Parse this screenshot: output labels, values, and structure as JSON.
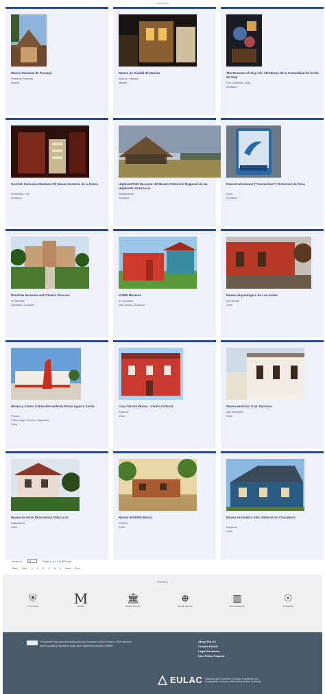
{
  "museums": [
    {
      "title": "Museo Nacional de Panamá",
      "lines": [
        "Panamá, Panamá",
        "Madrid"
      ]
    },
    {
      "title": "Museo de Ciudad de Mexico",
      "lines": [
        "Ramos, Oaxaca",
        "Madrid"
      ]
    },
    {
      "title": "The Museum of Islay Life / El Museo de la Comunidad de la Isla de Islay",
      "lines": [
        "Port Charlotte, Islay",
        "Scotland"
      ]
    },
    {
      "title": "Scottish Fisheries Museum / El Museo Escocés de la Pesca",
      "lines": [
        "Anstruther, Fife",
        "Scotland"
      ]
    },
    {
      "title": "Highland Folk Museum / El Museo Folclórico Regional de las Highlands de Escocia",
      "lines": [
        "Newtonmore",
        "Scotland"
      ]
    },
    {
      "title": "Deva Environment (\"Connection\") / Entornos de Deva",
      "lines": [
        "Deva",
        "Scotland"
      ]
    },
    {
      "title": "Dumfries Museum and Camera Obscura",
      "lines": [
        "St. Michael",
        "Dumfries, Scotland"
      ]
    },
    {
      "title": "KOME Museum",
      "lines": [
        "St. Andrews",
        "Villa Nueva, Scotland"
      ]
    },
    {
      "title": "Museo Arqueológico de Los Andes",
      "lines": [
        "Los Andes",
        "Chile"
      ]
    },
    {
      "title": "Museo y Centro Cultural Presidente Pedro Aguirre Cerda",
      "lines": [
        "Pocuro",
        "Calle Larga, Pocuro, Valparaíso",
        "Chile"
      ]
    },
    {
      "title": "Casa Tornini Museo - Centro Cultural",
      "lines": [
        "Caldera",
        "Chile"
      ]
    },
    {
      "title": "Museo Histórico Gral. Pacheco",
      "lines": [
        "San Bernardo",
        "Chile"
      ]
    },
    {
      "title": "Museo de Artes Decorativas Villa Lucía",
      "lines": [
        "Cauquenes",
        "Chile"
      ]
    },
    {
      "title": "Museo del Bello Bosco",
      "lines": [
        "Pinares",
        "Chile"
      ]
    },
    {
      "title": "Museo Granadero Alex. Ballesteros Chacabuco",
      "lines": [
        "Sargento",
        "Chile"
      ]
    }
  ],
  "pagination": {
    "results_label": "Items on",
    "per_page": "15",
    "results_suffix": "Page 1 of 14 (198 total)",
    "first": "Start",
    "prev": "Prev",
    "pages": [
      "1",
      "2",
      "3",
      "4",
      "5",
      "6"
    ],
    "next": "Next",
    "last": "End"
  },
  "partners": {
    "title": "Partners",
    "logos": [
      {
        "icon": "crest-icon",
        "glyph": "⛨",
        "caption": "Universidad"
      },
      {
        "icon": "museo-icon",
        "glyph": "M",
        "caption": "MUSEO"
      },
      {
        "icon": "temple-icon",
        "glyph": "🏛",
        "caption": "Museo Nacional"
      },
      {
        "icon": "globe-icon",
        "glyph": "⊕",
        "caption": "Red de Museos"
      },
      {
        "icon": "building-icon",
        "glyph": "▥",
        "caption": "Museo Regional"
      },
      {
        "icon": "seal-icon",
        "glyph": "☉",
        "caption": "Universidad"
      }
    ]
  },
  "footer": {
    "text_lines": [
      "This project has received funding from the European Union's Horizon 2020 research",
      "and innovation programme under grant agreement number 693669"
    ],
    "links": [
      "About EULAC",
      "Contact Details",
      "Legal Disclaimer",
      "Data Policy Request"
    ],
    "brand": "EULAC",
    "brand_sub": "Museums and Community: Concepts, Experiences and Sustainability in Europe, Latin America and the Caribbean"
  },
  "colors": {
    "card_border": "#2e4a8f",
    "card_bg": "#eef1f9",
    "footer_bg": "#4a5a6b"
  }
}
